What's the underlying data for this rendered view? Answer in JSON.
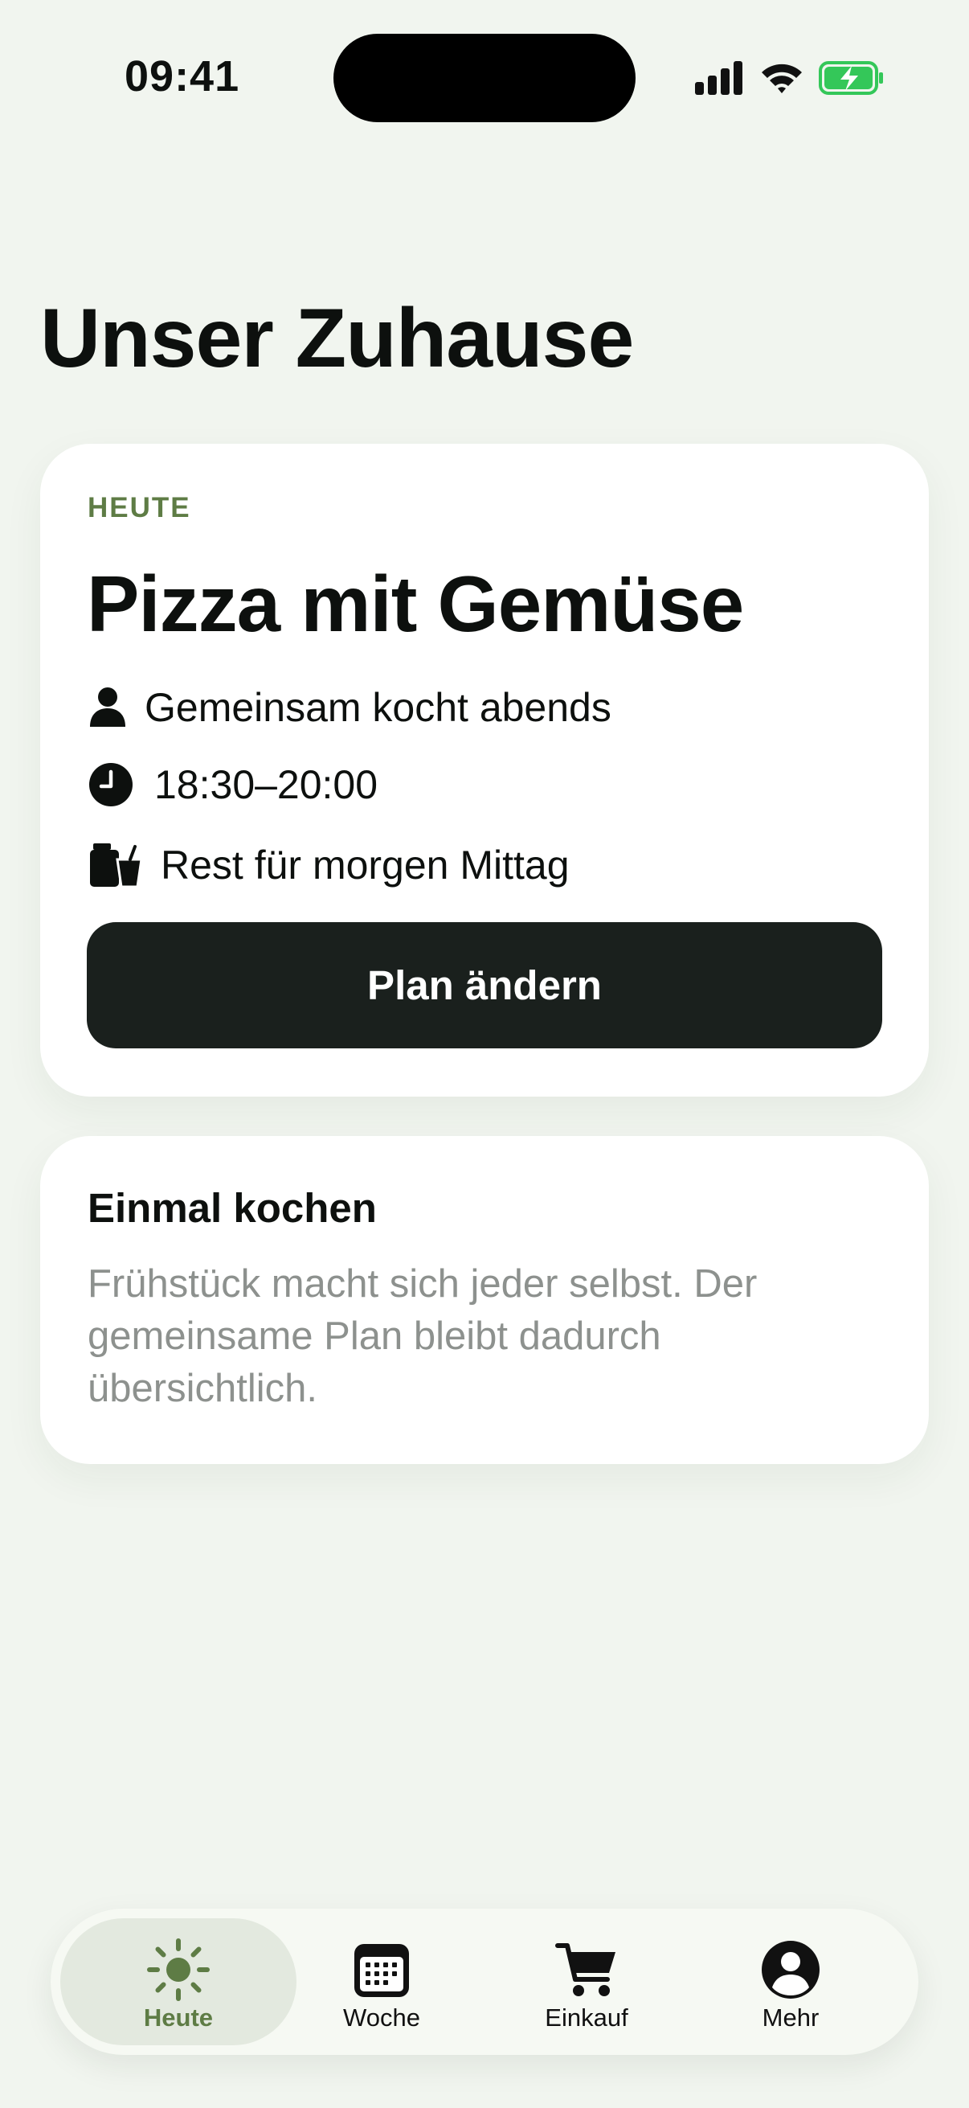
{
  "status_bar": {
    "time": "09:41",
    "icons": [
      "cellular-signal-icon",
      "wifi-icon",
      "battery-charging-icon"
    ],
    "battery_color": "#34c759"
  },
  "page": {
    "title": "Unser Zuhause"
  },
  "today_card": {
    "eyebrow": "HEUTE",
    "meal": "Pizza mit Gemüse",
    "rows": [
      {
        "icon": "person-icon",
        "text": "Gemeinsam kocht abends"
      },
      {
        "icon": "clock-icon",
        "text": "18:30–20:00"
      },
      {
        "icon": "leftovers-icon",
        "text": "Rest für morgen Mittag"
      }
    ],
    "button_label": "Plan ändern"
  },
  "info_card": {
    "title": "Einmal kochen",
    "body": "Frühstück macht sich jeder selbst. Der gemeinsame Plan bleibt dadurch übersichtlich."
  },
  "tab_bar": {
    "active": "Heute",
    "accent": "#5e7c45",
    "tabs": [
      {
        "label": "Heute",
        "icon": "sun-icon"
      },
      {
        "label": "Woche",
        "icon": "calendar-icon"
      },
      {
        "label": "Einkauf",
        "icon": "cart-icon"
      },
      {
        "label": "Mehr",
        "icon": "account-icon"
      }
    ]
  }
}
